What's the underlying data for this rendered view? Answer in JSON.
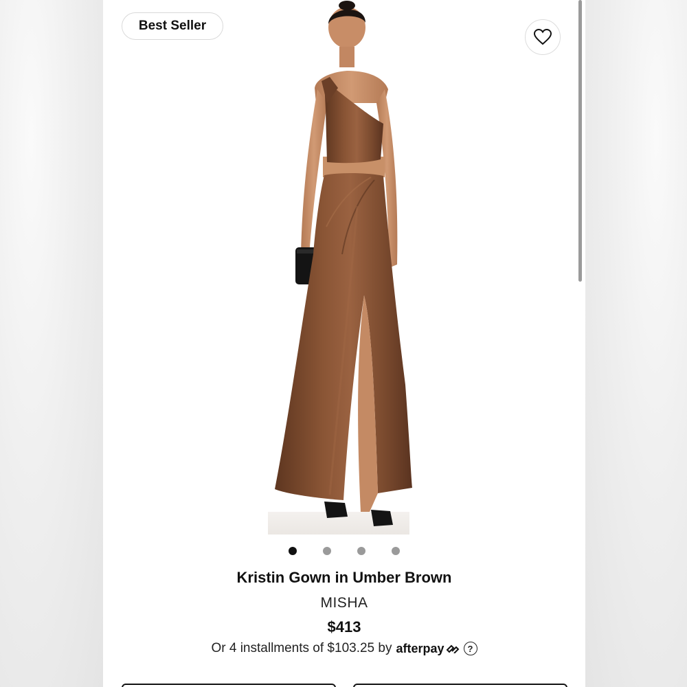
{
  "badge": {
    "label": "Best Seller"
  },
  "wishlist": {
    "icon": "heart-icon"
  },
  "gallery": {
    "image_count": 4,
    "active_index": 0
  },
  "product": {
    "title": "Kristin Gown in Umber Brown",
    "brand": "MISHA",
    "price": "$413"
  },
  "payment": {
    "installments_text": "Or 4 installments of $103.25 by",
    "provider": "afterpay",
    "help_icon": "?"
  },
  "colors": {
    "dress": "#7a4a2e",
    "accent": "#111111"
  }
}
